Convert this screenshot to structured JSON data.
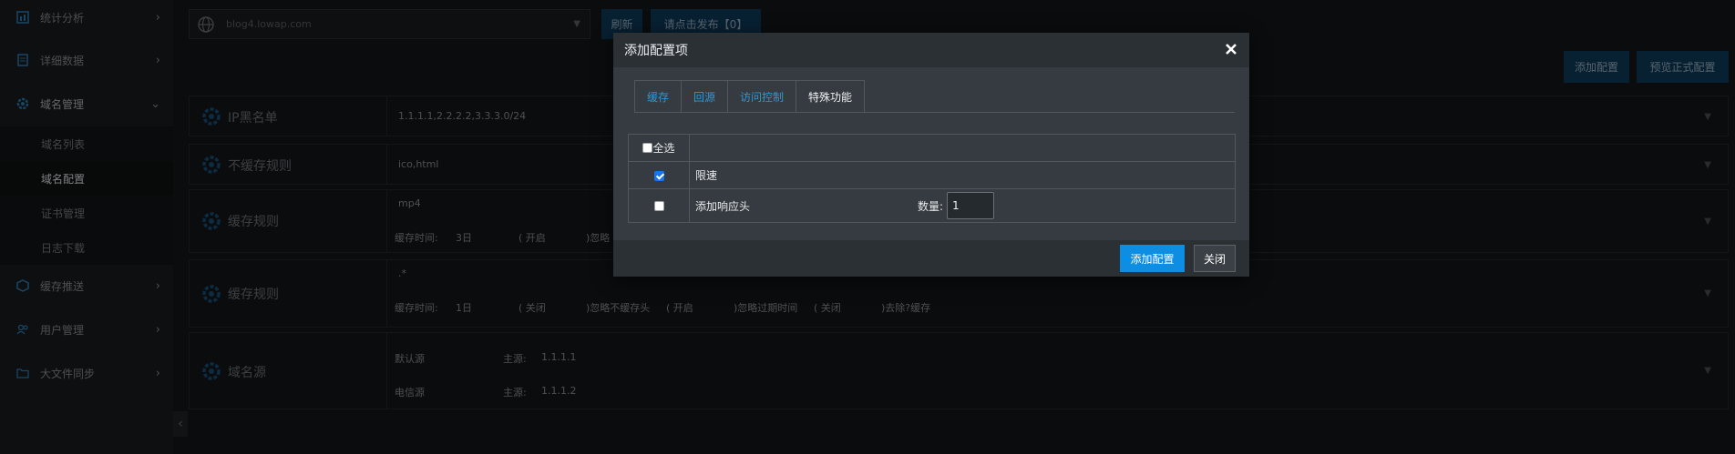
{
  "sidebar": {
    "items": [
      {
        "label": "统计分析",
        "icon": "chart-icon"
      },
      {
        "label": "详细数据",
        "icon": "document-icon"
      },
      {
        "label": "域名管理",
        "icon": "gear-icon"
      },
      {
        "label": "缓存推送",
        "icon": "cube-icon"
      },
      {
        "label": "用户管理",
        "icon": "users-icon"
      },
      {
        "label": "大文件同步",
        "icon": "folder-icon"
      }
    ],
    "sub_items": [
      "域名列表",
      "域名配置",
      "证书管理",
      "日志下载"
    ]
  },
  "toolbar": {
    "domain_value": "blog4.lowap.com",
    "refresh_label": "刷新",
    "publish_label": "请点击发布【0】",
    "add_config_label": "添加配置",
    "preview_label": "预览正式配置"
  },
  "rows": [
    {
      "title": "IP黑名单",
      "values": [
        "1.1.1.1,2.2.2.2,3.3.3.0/24"
      ]
    },
    {
      "title": "不缓存规则",
      "values": [
        "ico,html"
      ]
    },
    {
      "title": "缓存规则",
      "values": [
        "mp4",
        "缓存时间:",
        "3日",
        "( 开启",
        ")忽略"
      ]
    },
    {
      "title": "缓存规则",
      "values": [
        ".*",
        "缓存时间:",
        "1日",
        "( 关闭",
        ")忽略不缓存头",
        "( 开启",
        ")忽略过期时间",
        "( 关闭",
        ")去除?缓存"
      ]
    },
    {
      "title": "域名源",
      "values": [
        "默认源",
        "主源:",
        "1.1.1.1",
        "电信源",
        "主源:",
        "1.1.1.2"
      ]
    }
  ],
  "modal": {
    "title": "添加配置项",
    "tabs": [
      "缓存",
      "回源",
      "访问控制",
      "特殊功能"
    ],
    "active_tab": "特殊功能",
    "select_all_label": "全选",
    "features": [
      {
        "label": "限速",
        "checked": true
      },
      {
        "label": "添加响应头",
        "checked": false
      }
    ],
    "qty_label": "数量:",
    "qty_value": "1",
    "add_button": "添加配置",
    "close_button": "关闭"
  },
  "colors": {
    "accent": "#0d8ee3",
    "tab_link": "#2e97d6",
    "background": "#141618"
  }
}
